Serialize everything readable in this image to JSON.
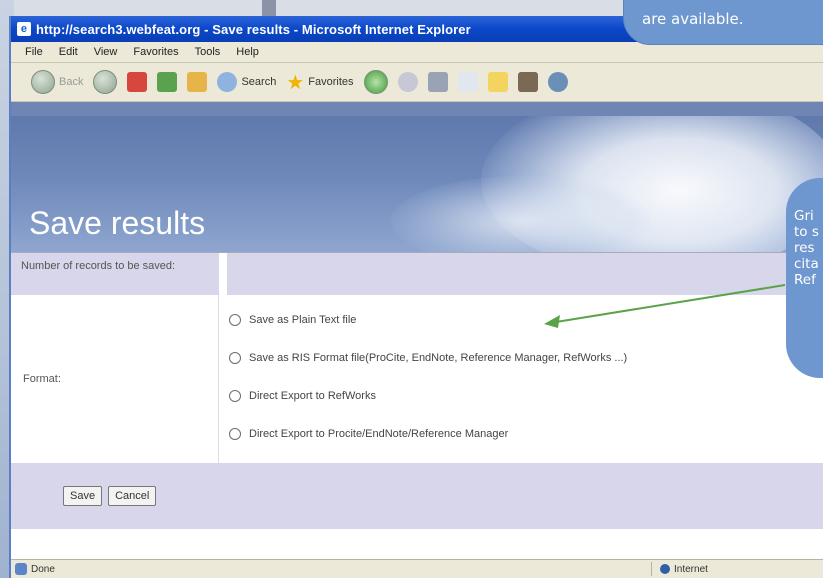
{
  "window": {
    "title": "http://search3.webfeat.org - Save results - Microsoft Internet Explorer"
  },
  "menu": [
    "File",
    "Edit",
    "View",
    "Favorites",
    "Tools",
    "Help"
  ],
  "toolbar": {
    "back_label": "Back",
    "search_label": "Search",
    "favorites_label": "Favorites"
  },
  "page": {
    "heading": "Save results",
    "records_label": "Number of records to be saved:",
    "format_label": "Format:",
    "options": [
      {
        "label": "Save as Plain Text file",
        "selected": false
      },
      {
        "label": "Save as RIS Format file(ProCite, EndNote, Reference Manager, RefWorks ...)",
        "selected": false
      },
      {
        "label": "Direct Export to RefWorks",
        "selected": false
      },
      {
        "label": "Direct Export to Procite/EndNote/Reference Manager",
        "selected": false
      }
    ],
    "save_button": "Save",
    "cancel_button": "Cancel"
  },
  "status": {
    "left": "Done",
    "zone": "Internet"
  },
  "callouts": {
    "top": "are available.",
    "right": [
      "Gri",
      "to s",
      "res",
      "cita",
      "Ref"
    ]
  },
  "colors": {
    "titlebar": "#0b47c9",
    "banner": "#6e88ba",
    "form_band": "#d8d6ea",
    "callout": "#6e96cf",
    "arrow": "#5aa34a"
  }
}
